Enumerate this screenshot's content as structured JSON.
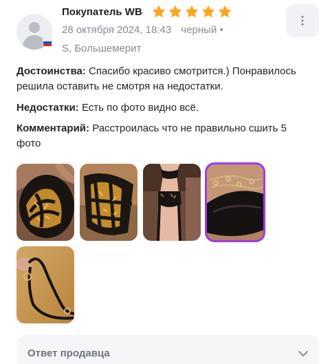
{
  "review": {
    "author": "Покупатель WB",
    "rating": 5,
    "rating_max": 5,
    "date": "28 октября 2024, 18:43",
    "color": "черный",
    "bullet": "•",
    "size": "S, Большемерит",
    "pros_label": "Достоинства:",
    "pros": "Спасибо красиво смотрится.) Понравилось решила оставить не смотря на недостатки.",
    "cons_label": "Недостатки:",
    "cons": "Есть по фото видно всё.",
    "comment_label": "Комментарий:",
    "comment": "Расстроилась что не правильно сшить 5 фото"
  },
  "icons": {
    "avatar": "user-avatar-placeholder",
    "flag": "russia-flag-icon",
    "star": "star-icon",
    "menu": "more-vertical-icon",
    "chevron": "chevron-down-icon"
  },
  "photos": [
    {
      "name": "photo-1",
      "desc": "lingerie-cups-gold-embroidery",
      "selected": false
    },
    {
      "name": "photo-2",
      "desc": "lingerie-straps-gold-embroidery",
      "selected": false
    },
    {
      "name": "photo-3",
      "desc": "lingerie-set-worn",
      "selected": false
    },
    {
      "name": "photo-4",
      "desc": "lingerie-closeup-lace",
      "selected": true
    },
    {
      "name": "photo-5",
      "desc": "strap-with-ring",
      "selected": false
    }
  ],
  "seller_reply": {
    "label": "Ответ продавца"
  },
  "colors": {
    "star": "#ffa41b",
    "accent": "#9b3de6",
    "muted": "#868a93"
  }
}
